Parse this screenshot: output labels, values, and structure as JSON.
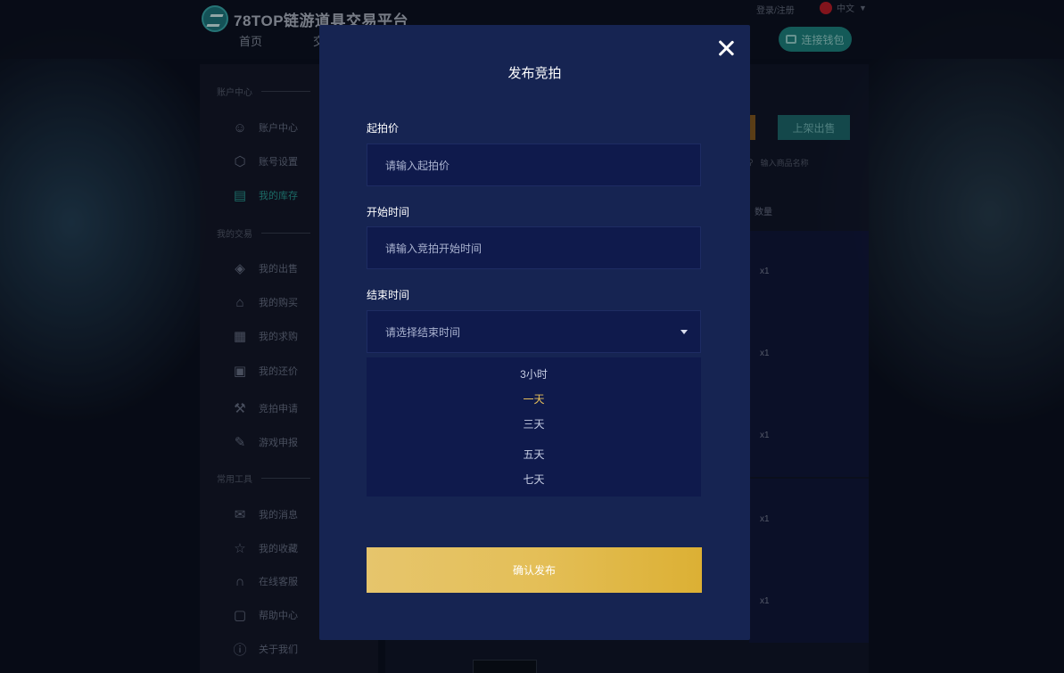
{
  "header": {
    "logo_text": "78TOP链游道具交易平台",
    "nav_home": "首页",
    "nav_trade": "交",
    "login_register": "登录/注册",
    "language": "中文",
    "connect_wallet": "连接钱包"
  },
  "sidebar": {
    "section_account": "账户中心",
    "section_trade": "我的交易",
    "section_tools": "常用工具",
    "items": [
      {
        "label": "账户中心",
        "icon": "user-icon"
      },
      {
        "label": "账号设置",
        "icon": "settings-icon"
      },
      {
        "label": "我的库存",
        "icon": "inventory-icon"
      },
      {
        "label": "我的出售",
        "icon": "tag-icon"
      },
      {
        "label": "我的购买",
        "icon": "bag-icon"
      },
      {
        "label": "我的求购",
        "icon": "request-icon"
      },
      {
        "label": "我的还价",
        "icon": "bargain-icon"
      },
      {
        "label": "竞拍申请",
        "icon": "auction-icon"
      },
      {
        "label": "游戏申报",
        "icon": "report-icon"
      },
      {
        "label": "我的消息",
        "icon": "mail-icon"
      },
      {
        "label": "我的收藏",
        "icon": "star-icon"
      },
      {
        "label": "在线客服",
        "icon": "headset-icon"
      },
      {
        "label": "帮助中心",
        "icon": "help-icon"
      },
      {
        "label": "关于我们",
        "icon": "info-icon"
      }
    ]
  },
  "main": {
    "list_button": "上架出售",
    "search_placeholder": "输入商品名称",
    "column_qty": "数量",
    "rows": [
      {
        "qty": "x1"
      },
      {
        "qty": "x1"
      },
      {
        "qty": "x1"
      },
      {
        "qty": "x1"
      },
      {
        "qty": "x1"
      }
    ]
  },
  "modal": {
    "title": "发布竞拍",
    "start_price_label": "起拍价",
    "start_price_placeholder": "请输入起拍价",
    "start_time_label": "开始时间",
    "start_time_placeholder": "请输入竞拍开始时间",
    "end_time_label": "结束时间",
    "end_time_placeholder": "请选择结束时间",
    "end_time_options": [
      "3小时",
      "一天",
      "三天",
      "五天",
      "七天"
    ],
    "highlighted_option": "一天",
    "confirm_button": "确认发布"
  }
}
